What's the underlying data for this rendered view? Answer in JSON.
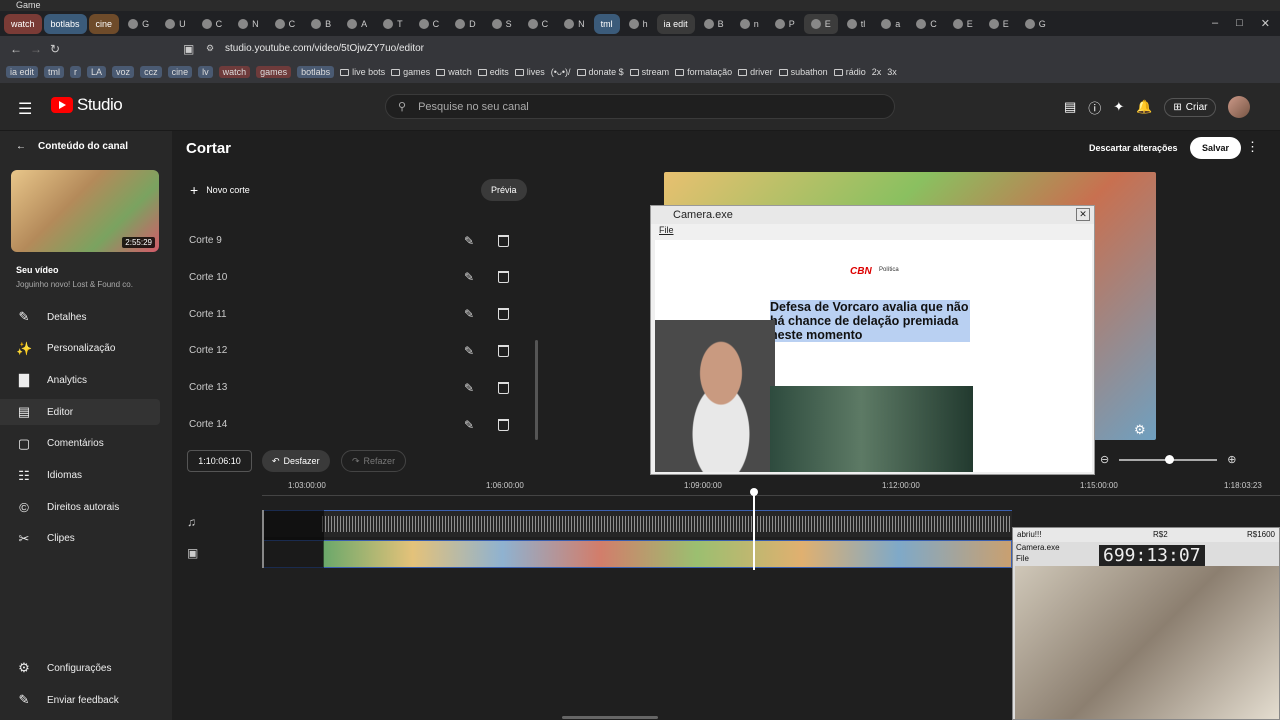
{
  "window": {
    "title": "Game"
  },
  "tabs": [
    {
      "label": "watch",
      "kind": "group",
      "color": "#7a3b36"
    },
    {
      "label": "botlabs",
      "kind": "group",
      "color": "#3b5b7a"
    },
    {
      "label": "cine",
      "kind": "group",
      "color": "#6e4b2a"
    },
    {
      "label": "G"
    },
    {
      "label": "U"
    },
    {
      "label": "C"
    },
    {
      "label": "N"
    },
    {
      "label": "C"
    },
    {
      "label": "B"
    },
    {
      "label": "A"
    },
    {
      "label": "T"
    },
    {
      "label": "C"
    },
    {
      "label": "D"
    },
    {
      "label": "S"
    },
    {
      "label": "C"
    },
    {
      "label": "N"
    },
    {
      "label": "tml",
      "kind": "group",
      "color": "#3b5b7a"
    },
    {
      "label": "h"
    },
    {
      "label": "ia edit",
      "kind": "group",
      "color": "#3a3a3a"
    },
    {
      "label": "B"
    },
    {
      "label": "n"
    },
    {
      "label": "P"
    },
    {
      "label": "E",
      "active": true
    },
    {
      "label": "tl"
    },
    {
      "label": "a"
    },
    {
      "label": "C"
    },
    {
      "label": "E"
    },
    {
      "label": "E"
    },
    {
      "label": "G"
    }
  ],
  "address": {
    "url": "studio.youtube.com/video/5tOjwZY7uo/editor"
  },
  "bookmarks": [
    {
      "label": "ia edit",
      "chip": true
    },
    {
      "label": "tml",
      "chip": true
    },
    {
      "label": "r",
      "chip": true
    },
    {
      "label": "LA",
      "chip": true
    },
    {
      "label": "voz",
      "chip": true
    },
    {
      "label": "ccz",
      "chip": true
    },
    {
      "label": "cine",
      "chip": true
    },
    {
      "label": "lv",
      "chip": true
    },
    {
      "label": "watch",
      "chip": "red"
    },
    {
      "label": "games",
      "chip": "red"
    },
    {
      "label": "botlabs",
      "chip": true
    },
    {
      "label": "live bots",
      "folder": true
    },
    {
      "label": "games",
      "folder": true
    },
    {
      "label": "watch",
      "folder": true
    },
    {
      "label": "edits",
      "folder": true
    },
    {
      "label": "lives",
      "folder": true
    },
    {
      "label": "(•ᴗ•)/",
      "folder": false
    },
    {
      "label": "donate $",
      "folder": true
    },
    {
      "label": "stream",
      "folder": true
    },
    {
      "label": "formatação",
      "folder": true
    },
    {
      "label": "driver",
      "folder": true
    },
    {
      "label": "subathon",
      "folder": true
    },
    {
      "label": "rádio",
      "folder": true
    },
    {
      "label": "2x",
      "folder": false
    },
    {
      "label": "3x",
      "folder": false
    }
  ],
  "studio": {
    "logo": "Studio",
    "search_placeholder": "Pesquise no seu canal",
    "criar": "Criar"
  },
  "sidebar": {
    "back_label": "Conteúdo do canal",
    "thumb_duration": "2:55:29",
    "video_title": "Seu vídeo",
    "video_subtitle": "Joguinho novo! Lost & Found co.",
    "items": [
      {
        "label": "Detalhes",
        "icon": "pencil-icon"
      },
      {
        "label": "Personalização",
        "icon": "magic-icon"
      },
      {
        "label": "Analytics",
        "icon": "analytics-icon"
      },
      {
        "label": "Editor",
        "icon": "editor-icon",
        "selected": true
      },
      {
        "label": "Comentários",
        "icon": "comment-icon"
      },
      {
        "label": "Idiomas",
        "icon": "language-icon"
      },
      {
        "label": "Direitos autorais",
        "icon": "copyright-icon"
      },
      {
        "label": "Clipes",
        "icon": "scissors-icon"
      }
    ],
    "settings": "Configurações",
    "feedback": "Enviar feedback"
  },
  "editor": {
    "title": "Cortar",
    "new_cut": "Novo corte",
    "preview": "Prévia",
    "discard": "Descartar alterações",
    "save": "Salvar",
    "cuts": [
      "Corte 9",
      "Corte 10",
      "Corte 11",
      "Corte 12",
      "Corte 13",
      "Corte 14"
    ],
    "current_time": "1:10:06:10",
    "undo": "Desfazer",
    "redo": "Refazer",
    "ruler": [
      "1:03:00:00",
      "1:06:00:00",
      "1:09:00:00",
      "1:12:00:00",
      "1:15:00:00",
      "1:18:03:23"
    ]
  },
  "camera": {
    "title": "Camera.exe",
    "menu_file": "File",
    "site_logo": "CBN",
    "site_section": "Política",
    "headline": "Defesa de Vorcaro avalia que não há chance de delação premiada neste momento"
  },
  "overlay": {
    "bar_text": "abriu!!!",
    "bar_mid": "R$2",
    "bar_right": "R$1600",
    "title": "Camera.exe",
    "sub": "File",
    "counter": "699:13:07"
  }
}
